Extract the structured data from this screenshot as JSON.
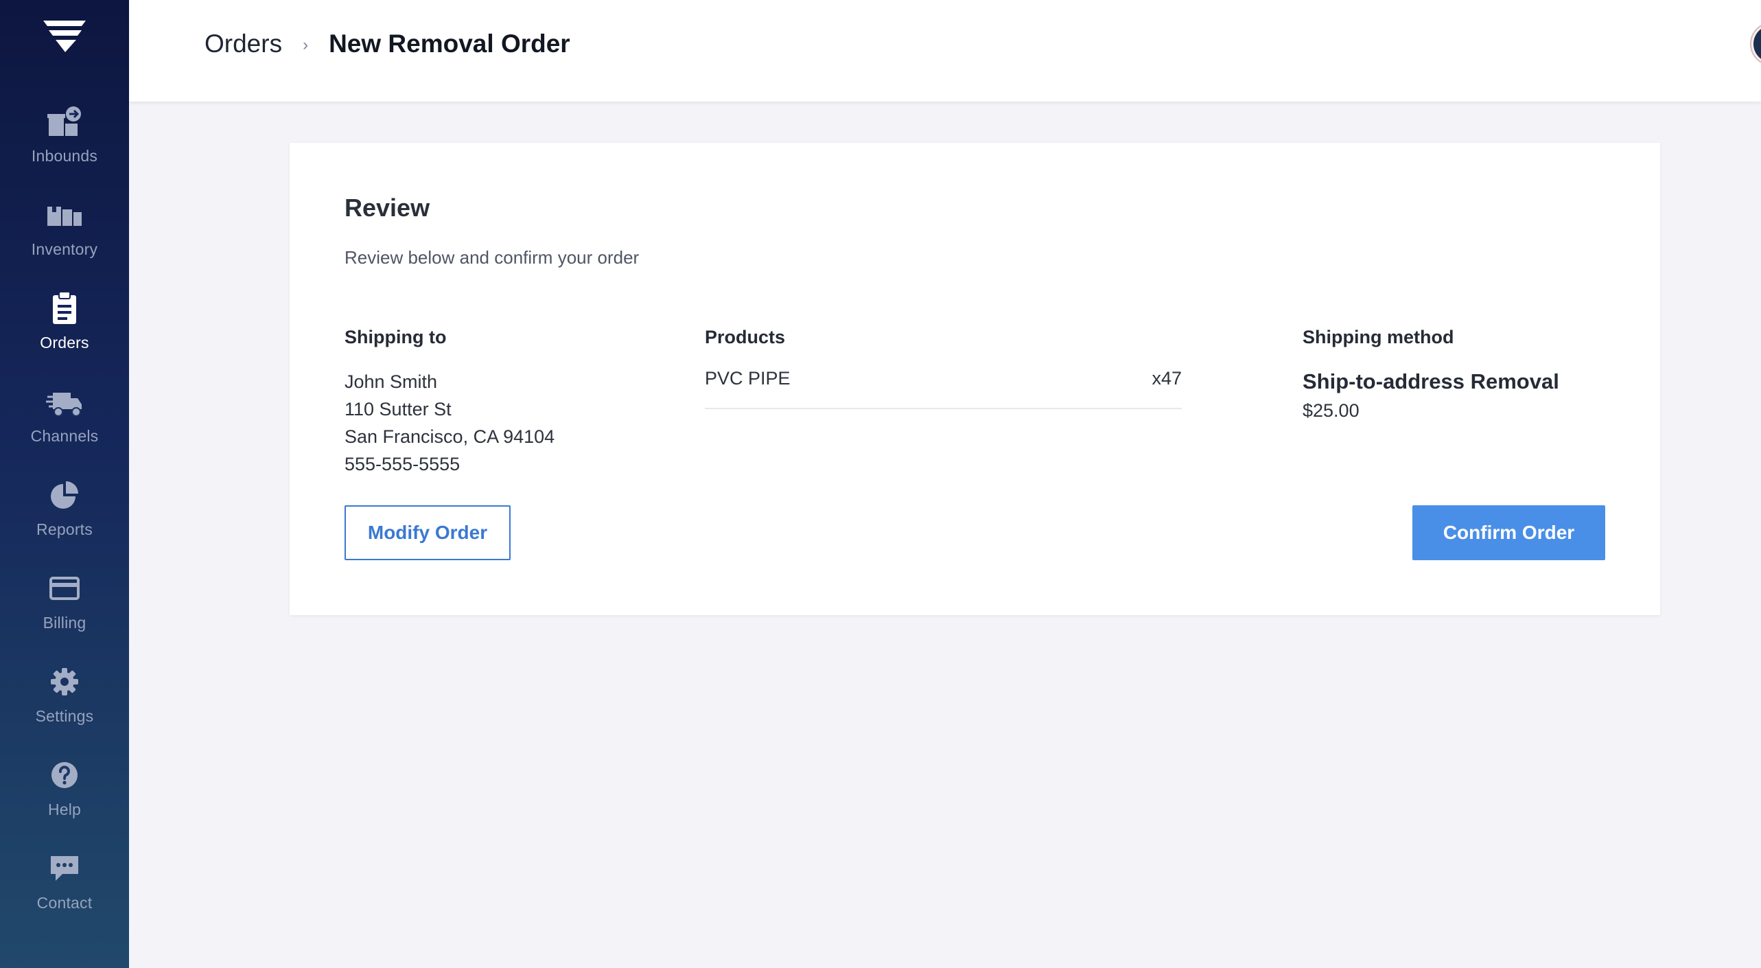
{
  "sidebar": {
    "logo": "brand-logo",
    "items": [
      {
        "label": "Inbounds",
        "icon": "inbound-box-icon",
        "active": false
      },
      {
        "label": "Inventory",
        "icon": "inventory-icon",
        "active": false
      },
      {
        "label": "Orders",
        "icon": "clipboard-icon",
        "active": true
      },
      {
        "label": "Channels",
        "icon": "delivery-truck-icon",
        "active": false
      },
      {
        "label": "Reports",
        "icon": "pie-chart-icon",
        "active": false
      },
      {
        "label": "Billing",
        "icon": "credit-card-icon",
        "active": false
      },
      {
        "label": "Settings",
        "icon": "gear-icon",
        "active": false
      },
      {
        "label": "Help",
        "icon": "question-icon",
        "active": false
      },
      {
        "label": "Contact",
        "icon": "chat-bubble-icon",
        "active": false
      }
    ]
  },
  "header": {
    "breadcrumb_root": "Orders",
    "breadcrumb_separator": "›",
    "title": "New Removal Order"
  },
  "review": {
    "title": "Review",
    "subtitle": "Review below and confirm your order",
    "shipping_to": {
      "heading": "Shipping to",
      "name": "John Smith",
      "street": "110 Sutter St",
      "city_state_zip": "San Francisco, CA 94104",
      "phone": "555-555-5555"
    },
    "products": {
      "heading": "Products",
      "items": [
        {
          "name": "PVC PIPE",
          "quantity": "x47"
        }
      ]
    },
    "shipping_method": {
      "heading": "Shipping method",
      "name": "Ship-to-address Removal",
      "price": "$25.00"
    },
    "modify_label": "Modify Order",
    "confirm_label": "Confirm Order"
  },
  "colors": {
    "sidebar_top": "#0d1640",
    "sidebar_bottom": "#21496b",
    "primary": "#4a8fe7",
    "outline": "#3a79d2",
    "page_bg": "#f4f4f8"
  }
}
